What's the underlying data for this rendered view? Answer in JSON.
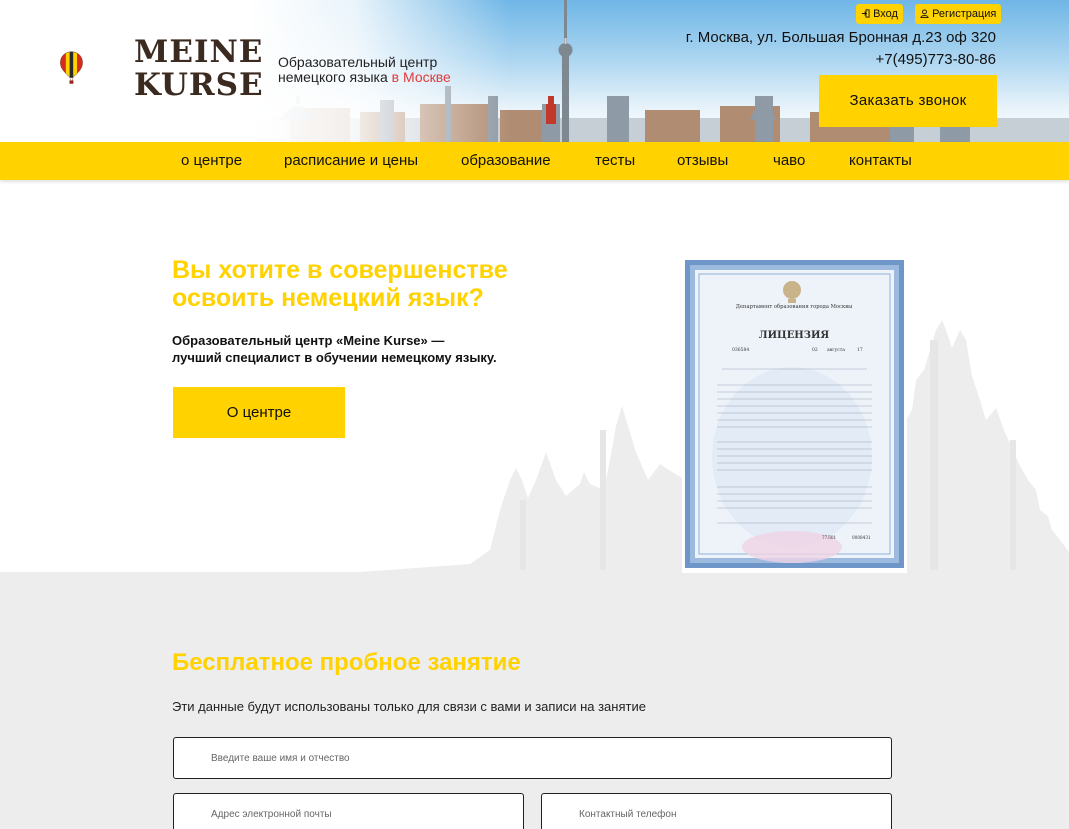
{
  "header": {
    "brand": [
      "MEINE",
      "KURSE"
    ],
    "tagline_line1": "Образовательный центр",
    "tagline_line2": "немецкого языка",
    "tagline_city": "в Москве",
    "login_label": "Вход",
    "register_label": "Регистрация",
    "address": "г. Москва, ул. Большая Бронная д.23 оф 320",
    "phone": "+7(495)773-80-86",
    "callback_label": "Заказать звонок"
  },
  "nav": {
    "items": [
      "о центре",
      "расписание и цены",
      "образование",
      "тесты",
      "отзывы",
      "чаво",
      "контакты"
    ]
  },
  "hero": {
    "title_line1": "Вы хотите в совершенстве",
    "title_line2": "освоить немецкий язык?",
    "subtitle_line1": "Образовательный центр «Meine Kurse» —",
    "subtitle_line2": "лучший специалист в обучении немецкому языку.",
    "about_label": "О центре"
  },
  "license": {
    "department": "Департамент образования города Москвы",
    "heading": "ЛИЦЕНЗИЯ",
    "number": "036584",
    "day": "02",
    "month": "августа",
    "year": "17",
    "form_number": "77Л01",
    "serial": "0008431"
  },
  "form": {
    "title": "Бесплатное пробное занятие",
    "note": "Эти данные будут использованы только для связи с вами и записи на занятие",
    "name_placeholder": "Введите ваше имя и отчество",
    "email_placeholder": "Адрес электронной почты",
    "phone_placeholder": "Контактный телефон"
  },
  "colors": {
    "accent": "#ffd200",
    "brand_text": "#3b2a20",
    "city_highlight": "#e23b3b",
    "grey_section": "#ededed"
  }
}
